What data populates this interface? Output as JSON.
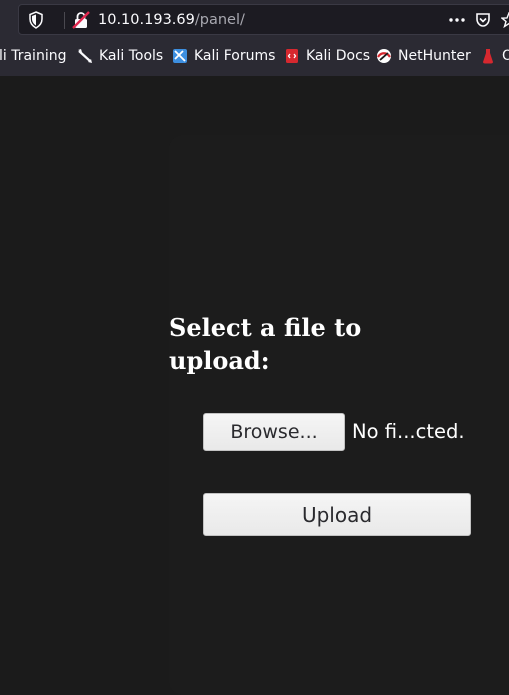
{
  "browser": {
    "url_host": "10.10.193.69",
    "url_path": "/panel/",
    "icons": [
      "shield-icon",
      "insecure-lock-icon",
      "more-actions-icon",
      "pocket-icon",
      "bookmark-star-icon"
    ]
  },
  "bookmarks": [
    {
      "label": "li Training",
      "icon": "kali-training-icon"
    },
    {
      "label": "Kali Tools",
      "icon": "kali-tools-icon"
    },
    {
      "label": "Kali Forums",
      "icon": "kali-forums-icon"
    },
    {
      "label": "Kali Docs",
      "icon": "kali-docs-icon"
    },
    {
      "label": "NetHunter",
      "icon": "nethunter-icon"
    },
    {
      "label": "O",
      "icon": "offsec-icon"
    }
  ],
  "form": {
    "heading": "Select a file to upload:",
    "browse_label": "Browse...",
    "file_status": "No fi...cted.",
    "upload_label": "Upload"
  },
  "colors": {
    "page_background": "#1b1b1b",
    "chrome_background": "#2b2a33",
    "text": "#ffffff"
  }
}
